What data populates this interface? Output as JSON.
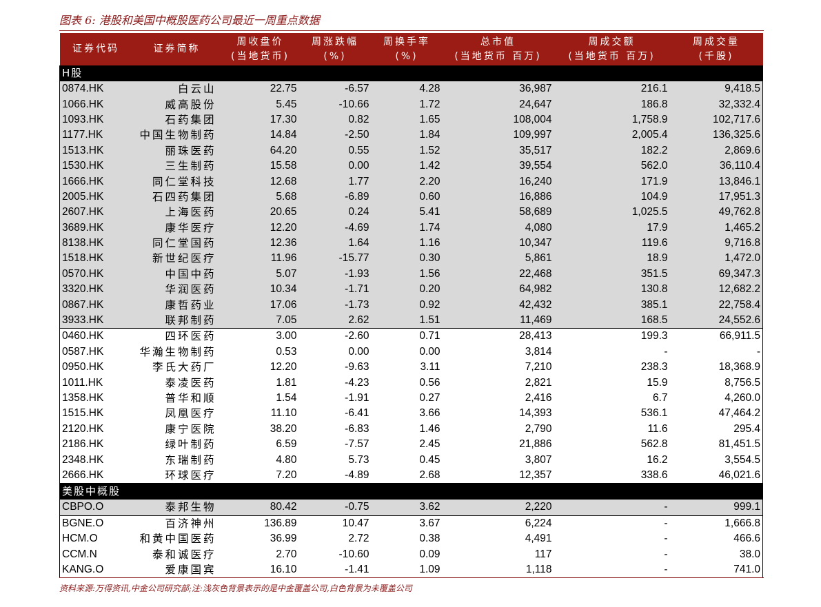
{
  "title": "图表 6: 港股和美国中概股医药公司最近一周重点数据",
  "headers": [
    [
      "证券代码",
      ""
    ],
    [
      "证券简称",
      ""
    ],
    [
      "周收盘价",
      "(当地货币)"
    ],
    [
      "周涨跌幅",
      "(%)"
    ],
    [
      "周换手率",
      "(%)"
    ],
    [
      "总市值",
      "(当地货币 百万)"
    ],
    [
      "周成交额",
      "(当地货币 百万)"
    ],
    [
      "周成交量",
      "(千股)"
    ]
  ],
  "sections": [
    {
      "label": "H股",
      "groups": [
        {
          "covered": true,
          "rows": [
            [
              "0874.HK",
              "白云山",
              "22.75",
              "-6.57",
              "4.28",
              "36,987",
              "216.1",
              "9,418.5"
            ],
            [
              "1066.HK",
              "威高股份",
              "5.45",
              "-10.66",
              "1.72",
              "24,647",
              "186.8",
              "32,332.4"
            ],
            [
              "1093.HK",
              "石药集团",
              "17.30",
              "0.82",
              "1.65",
              "108,004",
              "1,758.9",
              "102,717.6"
            ],
            [
              "1177.HK",
              "中国生物制药",
              "14.84",
              "-2.50",
              "1.84",
              "109,997",
              "2,005.4",
              "136,325.6"
            ],
            [
              "1513.HK",
              "丽珠医药",
              "64.20",
              "0.55",
              "1.52",
              "35,517",
              "182.2",
              "2,869.6"
            ],
            [
              "1530.HK",
              "三生制药",
              "15.58",
              "0.00",
              "1.42",
              "39,554",
              "562.0",
              "36,110.4"
            ],
            [
              "1666.HK",
              "同仁堂科技",
              "12.68",
              "1.77",
              "2.20",
              "16,240",
              "171.9",
              "13,846.1"
            ],
            [
              "2005.HK",
              "石四药集团",
              "5.68",
              "-6.89",
              "0.60",
              "16,886",
              "104.9",
              "17,951.3"
            ],
            [
              "2607.HK",
              "上海医药",
              "20.65",
              "0.24",
              "5.41",
              "58,689",
              "1,025.5",
              "49,762.8"
            ],
            [
              "3689.HK",
              "康华医疗",
              "12.20",
              "-4.69",
              "1.74",
              "4,080",
              "17.9",
              "1,465.2"
            ],
            [
              "8138.HK",
              "同仁堂国药",
              "12.36",
              "1.64",
              "1.16",
              "10,347",
              "119.6",
              "9,716.8"
            ],
            [
              "1518.HK",
              "新世纪医疗",
              "11.96",
              "-15.77",
              "0.30",
              "5,861",
              "18.9",
              "1,472.0"
            ],
            [
              "0570.HK",
              "中国中药",
              "5.07",
              "-1.93",
              "1.56",
              "22,468",
              "351.5",
              "69,347.3"
            ],
            [
              "3320.HK",
              "华润医药",
              "10.34",
              "-1.71",
              "0.20",
              "64,982",
              "130.8",
              "12,682.2"
            ],
            [
              "0867.HK",
              "康哲药业",
              "17.06",
              "-1.73",
              "0.92",
              "42,432",
              "385.1",
              "22,758.4"
            ],
            [
              "3933.HK",
              "联邦制药",
              "7.05",
              "2.62",
              "1.51",
              "11,469",
              "168.5",
              "24,552.6"
            ]
          ]
        },
        {
          "covered": false,
          "rows": [
            [
              "0460.HK",
              "四环医药",
              "3.00",
              "-2.60",
              "0.71",
              "28,413",
              "199.3",
              "66,911.5"
            ],
            [
              "0587.HK",
              "华瀚生物制药",
              "0.53",
              "0.00",
              "0.00",
              "3,814",
              "-",
              "-"
            ],
            [
              "0950.HK",
              "李氏大药厂",
              "12.20",
              "-9.63",
              "3.11",
              "7,210",
              "238.3",
              "18,368.9"
            ],
            [
              "1011.HK",
              "泰凌医药",
              "1.81",
              "-4.23",
              "0.56",
              "2,821",
              "15.9",
              "8,756.5"
            ],
            [
              "1358.HK",
              "普华和顺",
              "1.54",
              "-1.91",
              "0.27",
              "2,416",
              "6.7",
              "4,260.0"
            ],
            [
              "1515.HK",
              "凤凰医疗",
              "11.10",
              "-6.41",
              "3.66",
              "14,393",
              "536.1",
              "47,464.2"
            ],
            [
              "2120.HK",
              "康宁医院",
              "38.20",
              "-6.83",
              "1.46",
              "2,790",
              "11.6",
              "295.4"
            ],
            [
              "2186.HK",
              "绿叶制药",
              "6.59",
              "-7.57",
              "2.45",
              "21,886",
              "562.8",
              "81,451.5"
            ],
            [
              "2348.HK",
              "东瑞制药",
              "4.80",
              "5.73",
              "0.45",
              "3,807",
              "16.2",
              "3,554.5"
            ],
            [
              "2666.HK",
              "环球医疗",
              "7.20",
              "-4.89",
              "2.68",
              "12,357",
              "338.6",
              "46,021.6"
            ]
          ]
        }
      ]
    },
    {
      "label": "美股中概股",
      "groups": [
        {
          "covered": true,
          "rows": [
            [
              "CBPO.O",
              "泰邦生物",
              "80.42",
              "-0.75",
              "3.62",
              "2,220",
              "-",
              "999.1"
            ]
          ]
        },
        {
          "covered": false,
          "rows": [
            [
              "BGNE.O",
              "百济神州",
              "136.89",
              "10.47",
              "3.67",
              "6,224",
              "-",
              "1,666.8"
            ],
            [
              "HCM.O",
              "和黄中国医药",
              "36.99",
              "2.72",
              "0.38",
              "4,491",
              "-",
              "466.6"
            ],
            [
              "CCM.N",
              "泰和诚医疗",
              "2.70",
              "-10.60",
              "0.09",
              "117",
              "-",
              "38.0"
            ],
            [
              "KANG.O",
              "爱康国宾",
              "16.10",
              "-1.41",
              "1.09",
              "1,118",
              "-",
              "741.0"
            ]
          ]
        }
      ]
    }
  ],
  "source": "资料来源:万得资讯,中金公司研究部;注:浅灰色背景表示的是中金覆盖公司,白色背景为未覆盖公司",
  "colors": {
    "header_bg": "#9b1c14",
    "covered_bg": "#d9d9d9",
    "section_bg": "#000000",
    "accent": "#8b1a1a"
  }
}
